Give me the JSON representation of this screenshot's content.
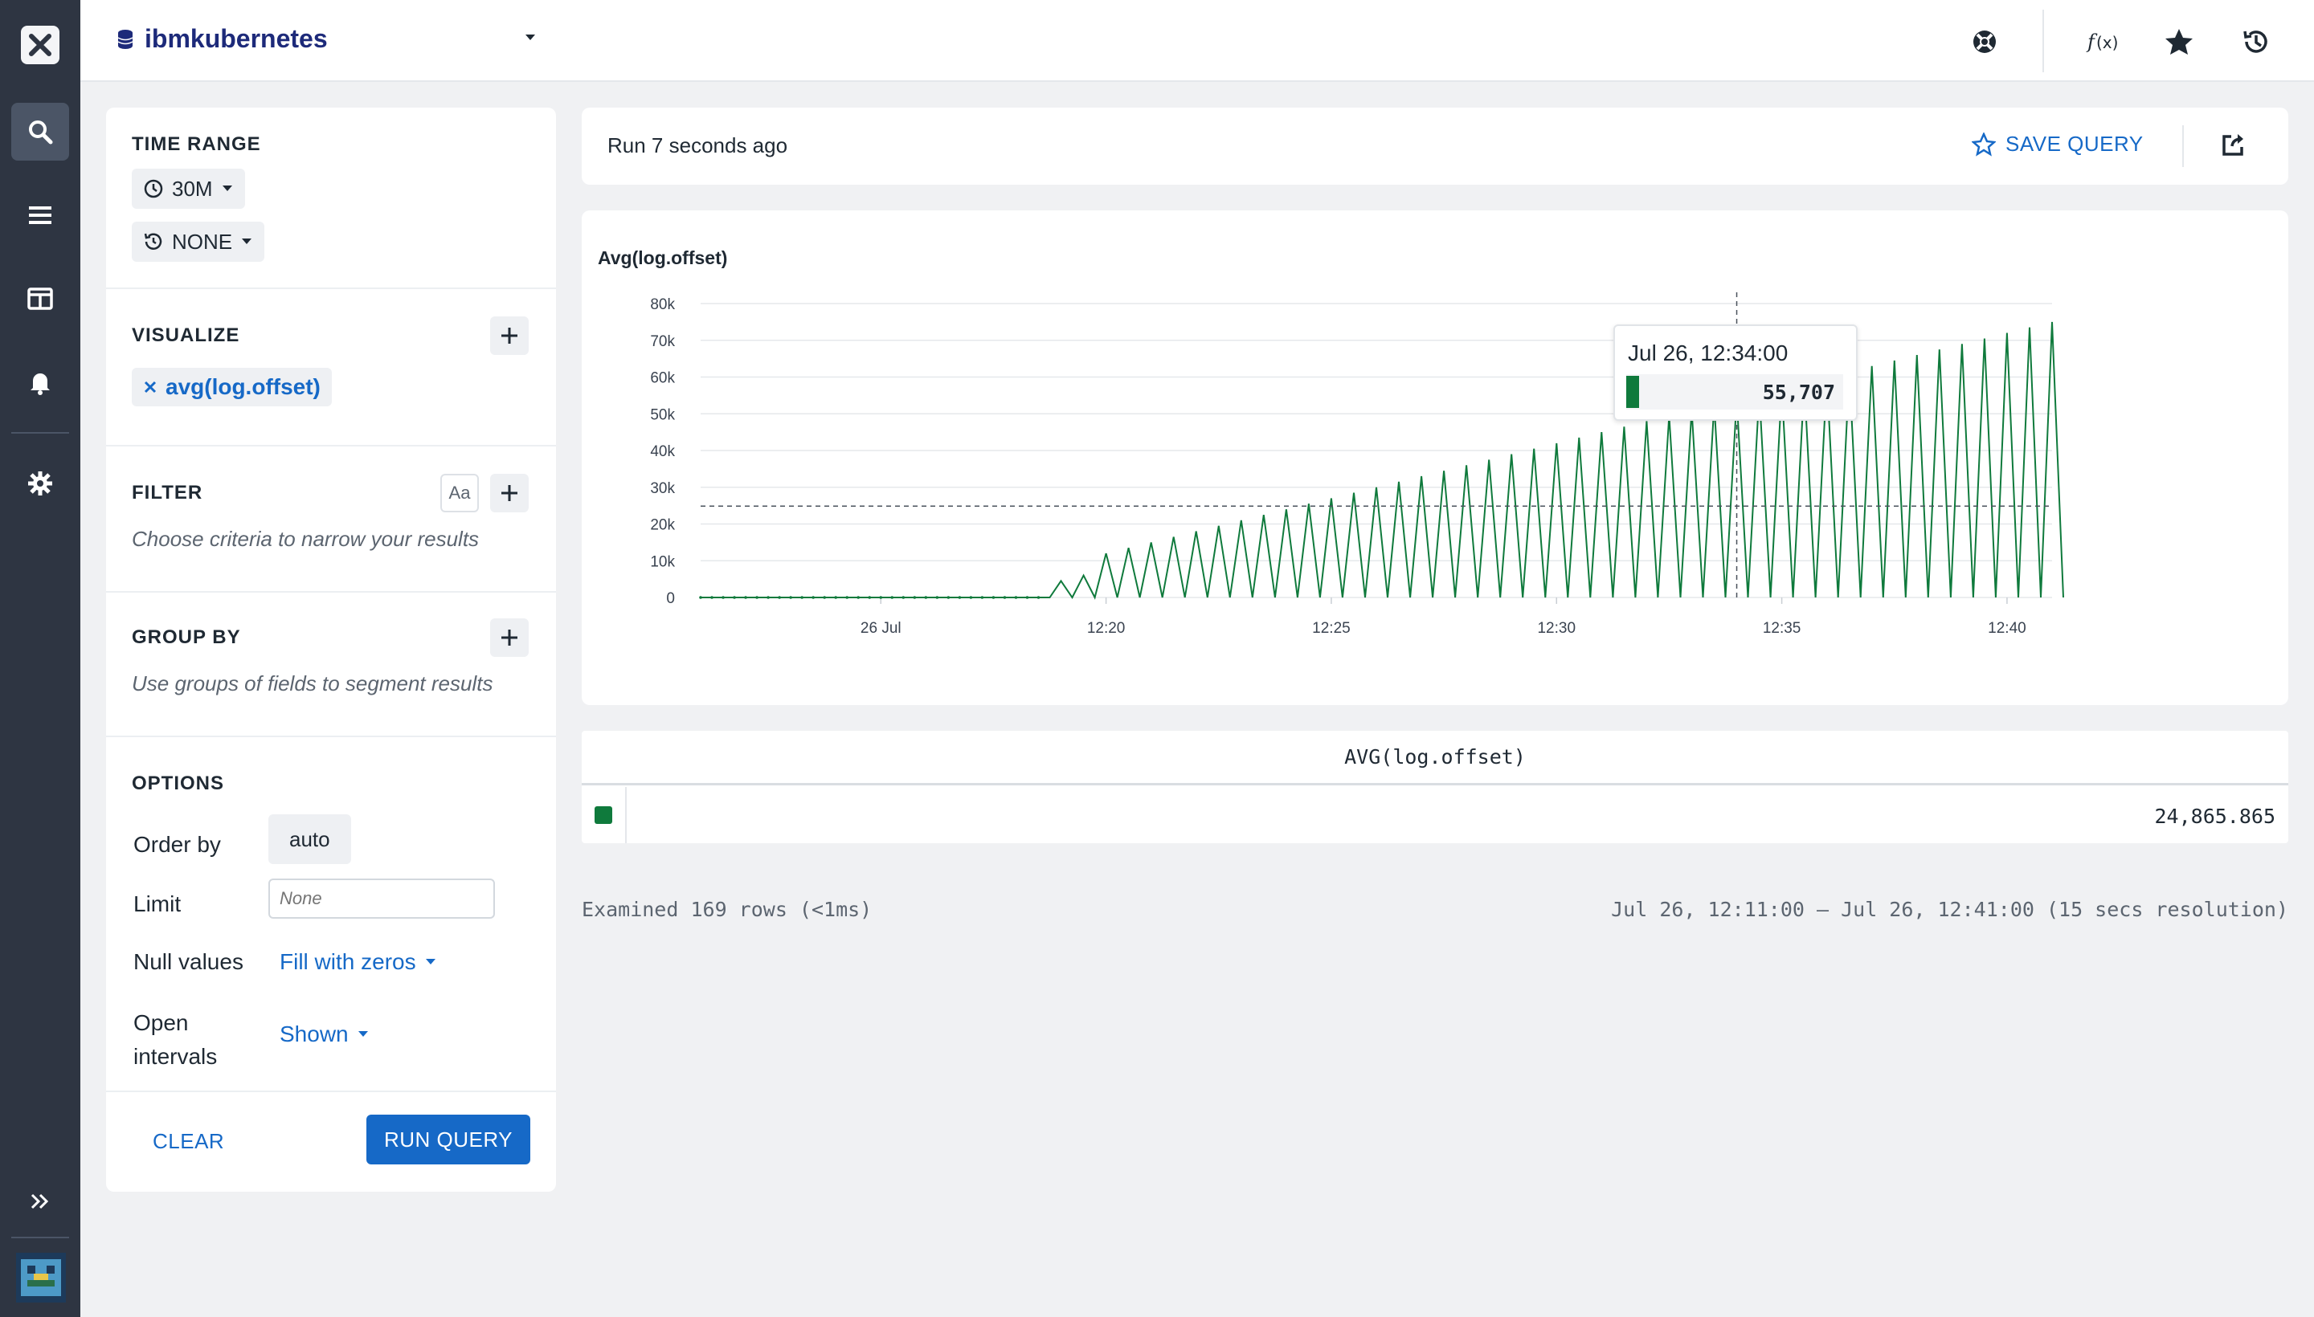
{
  "topbar": {
    "dataset": "ibmkubernetes"
  },
  "builder": {
    "time_range": {
      "title": "TIME RANGE",
      "range": "30M",
      "compare": "NONE"
    },
    "visualize": {
      "title": "VISUALIZE",
      "items": [
        "avg(log.offset)"
      ]
    },
    "filter": {
      "title": "FILTER",
      "case_toggle": "Aa",
      "hint": "Choose criteria to narrow your results"
    },
    "group_by": {
      "title": "GROUP BY",
      "hint": "Use groups of fields to segment results"
    },
    "options": {
      "title": "OPTIONS",
      "order_by_label": "Order by",
      "order_by_value": "auto",
      "limit_label": "Limit",
      "limit_placeholder": "None",
      "null_values_label": "Null values",
      "null_values_value": "Fill with zeros",
      "open_intervals_label_1": "Open",
      "open_intervals_label_2": "intervals",
      "open_intervals_value": "Shown"
    },
    "clear_label": "CLEAR",
    "run_label": "RUN QUERY"
  },
  "results": {
    "run_status": "Run 7 seconds ago",
    "save_label": "SAVE QUERY",
    "table_header": "AVG(log.offset)",
    "table_value": "24,865.865",
    "examined": "Examined 169 rows (<1ms)",
    "range_text": "Jul 26, 12:11:00 – Jul 26, 12:41:00 (15 secs resolution)"
  },
  "tooltip": {
    "time": "Jul 26, 12:34:00",
    "value": "55,707"
  },
  "colors": {
    "series": "#0f7a3c",
    "accent": "#1669c7",
    "rail": "#2e3542"
  },
  "chart_data": {
    "type": "line",
    "title": "Avg(log.offset)",
    "x_tick_labels": [
      "26 Jul",
      "12:20",
      "12:25",
      "12:30",
      "12:35",
      "12:40"
    ],
    "y_tick_labels": [
      "0",
      "10k",
      "20k",
      "30k",
      "40k",
      "50k",
      "60k",
      "70k",
      "80k"
    ],
    "ylim": [
      0,
      80000
    ],
    "xlim_minutes": [
      0,
      30
    ],
    "resolution_secs": 15,
    "average_line": 24865.865,
    "hover_x_minute": 23,
    "grid": true,
    "series": [
      {
        "start_minute": 7.75,
        "peaks": [
          4500,
          6000,
          12000,
          13500,
          15000,
          16500,
          18000,
          19500,
          21000,
          22500,
          24000,
          25500,
          27000,
          28500,
          30000,
          31500,
          33000,
          34500,
          36000,
          37500,
          39000,
          40500,
          42000,
          43500,
          45000,
          46500,
          48000,
          49500,
          51000,
          52500,
          54000,
          55707,
          57000,
          58500,
          60000,
          61500,
          63000,
          64500,
          66000,
          67500,
          69000,
          70500,
          72000,
          73500,
          75000
        ],
        "troughs": [
          0
        ]
      }
    ]
  }
}
